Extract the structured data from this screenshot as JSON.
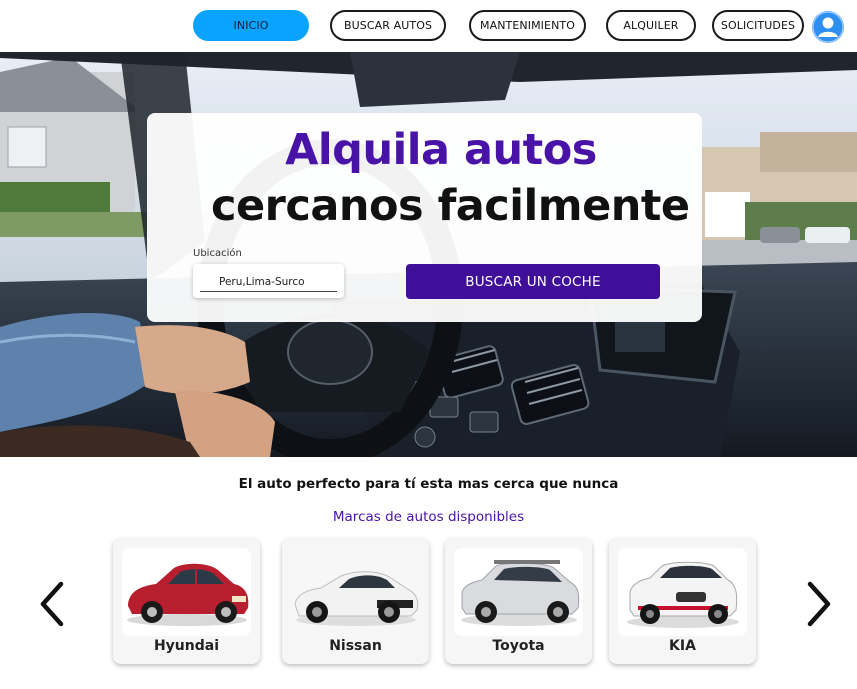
{
  "nav": {
    "items": [
      {
        "label": "INICIO",
        "active": true
      },
      {
        "label": "BUSCAR AUTOS",
        "active": false
      },
      {
        "label": "MANTENIMIENTO",
        "active": false
      },
      {
        "label": "ALQUILER",
        "active": false
      },
      {
        "label": "SOLICITUDES",
        "active": false
      }
    ],
    "avatar_icon": "user-avatar-icon"
  },
  "hero": {
    "title_line1": "Alquila autos",
    "title_line2": "cercanos facilmente",
    "location_label": "Ubicación",
    "location_value": "Peru,Lima-Surco",
    "search_button": "BUSCAR UN  COCHE"
  },
  "section": {
    "tagline": "El auto perfecto para tí esta mas cerca que nunca",
    "subtitle": "Marcas de autos disponibles"
  },
  "brands": [
    {
      "name": "Hyundai",
      "car_color": "#b81f2e"
    },
    {
      "name": "Nissan",
      "car_color": "#f2f2f2"
    },
    {
      "name": "Toyota",
      "car_color": "#d9dbde"
    },
    {
      "name": "KIA",
      "car_color": "#f4f4f4"
    }
  ],
  "colors": {
    "accent": "#0aa3ff",
    "brand_purple": "#4a13a8",
    "button_purple": "#3f0f9a"
  }
}
